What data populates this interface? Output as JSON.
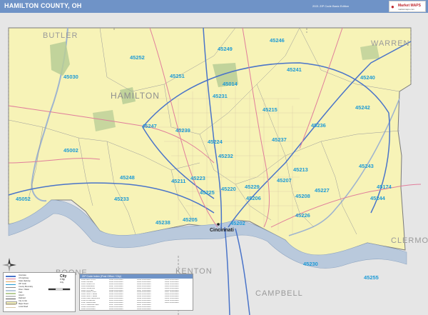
{
  "header": {
    "title": "HAMILTON COUNTY, OH",
    "edition": "2021 ZIP Code Basic Edition",
    "brand_name": "Market MAPS",
    "brand_tag": "marketmaps.com"
  },
  "colors": {
    "header_bar": "#6f93c7",
    "county_fill": "#f7f3b7",
    "surrounding": "#e6e6e6",
    "water": "#b9c9dc",
    "parks": "#b7cc96",
    "interstate": "#4a74c9",
    "highway": "#e07d9b",
    "zip_label": "#1f9bd6"
  },
  "map": {
    "counties": [
      {
        "label": "BUTLER"
      },
      {
        "label": "WARREN"
      },
      {
        "label": "HAMILTON"
      },
      {
        "label": "CLERMONT"
      },
      {
        "label": "BOONE"
      },
      {
        "label": "KENTON"
      },
      {
        "label": "CAMPBELL"
      }
    ],
    "city_label": "Cincinnati",
    "zip_codes": [
      "45246",
      "45249",
      "45252",
      "45241",
      "45030",
      "45251",
      "45240",
      "45014",
      "45231",
      "45215",
      "45242",
      "45247",
      "45239",
      "45236",
      "45224",
      "45237",
      "45002",
      "45232",
      "45213",
      "45243",
      "45248",
      "45211",
      "45223",
      "45220",
      "45229",
      "45207",
      "45227",
      "45174",
      "45052",
      "45233",
      "45225",
      "45206",
      "45208",
      "45244",
      "45238",
      "45205",
      "45202",
      "45226",
      "45230",
      "45255"
    ]
  },
  "legend": {
    "items": [
      {
        "label": "Interstate"
      },
      {
        "label": "US Highway"
      },
      {
        "label": "State Highway"
      },
      {
        "label": "ZIP Code"
      },
      {
        "label": "County Boundary"
      },
      {
        "label": "River / Water"
      },
      {
        "label": "Park"
      },
      {
        "label": "Airport"
      },
      {
        "label": "Railroad"
      },
      {
        "label": "City Limits"
      },
      {
        "label": "Major Road"
      },
      {
        "label": "Local Road"
      }
    ]
  },
  "city_legend": [
    "City",
    "City",
    "City"
  ],
  "zip_table": {
    "header": "ZIP Code Index (Post Office / City)",
    "rows": [
      "45001 ADDYSTON",
      "45002 CLEVES",
      "45013 HAMILTON",
      "45014 FAIRFIELD",
      "45030 HARRISON",
      "45033 HOOVEN",
      "45041 MIAMITOWN",
      "45051 NORTH BEND",
      "45052 NORTH BEND",
      "45111 CAMP DENNISON",
      "45140 LOVELAND",
      "45147 MIAMIVILLE",
      "45174 TERRACE PARK",
      "45202 CINCINNATI",
      "45203 CINCINNATI",
      "45204 CINCINNATI",
      "45205 CINCINNATI",
      "45206 CINCINNATI",
      "45207 CINCINNATI",
      "45208 CINCINNATI",
      "45209 CINCINNATI",
      "45211 CINCINNATI",
      "45212 CINCINNATI",
      "45213 CINCINNATI",
      "45214 CINCINNATI",
      "45215 CINCINNATI",
      "45216 CINCINNATI",
      "45217 CINCINNATI",
      "45218 CINCINNATI",
      "45219 CINCINNATI",
      "45220 CINCINNATI",
      "45223 CINCINNATI",
      "45224 CINCINNATI",
      "45225 CINCINNATI",
      "45226 CINCINNATI",
      "45227 CINCINNATI",
      "45229 CINCINNATI",
      "45230 CINCINNATI",
      "45231 CINCINNATI",
      "45232 CINCINNATI",
      "45233 CINCINNATI",
      "45236 CINCINNATI",
      "45237 CINCINNATI",
      "45238 CINCINNATI",
      "45239 CINCINNATI",
      "45240 CINCINNATI",
      "45241 CINCINNATI",
      "45242 CINCINNATI",
      "45243 CINCINNATI",
      "45244 CINCINNATI",
      "45246 CINCINNATI",
      "45247 CINCINNATI",
      "45248 CINCINNATI",
      "45249 CINCINNATI",
      "45251 CINCINNATI",
      "45252 CINCINNATI",
      "45255 CINCINNATI"
    ]
  }
}
